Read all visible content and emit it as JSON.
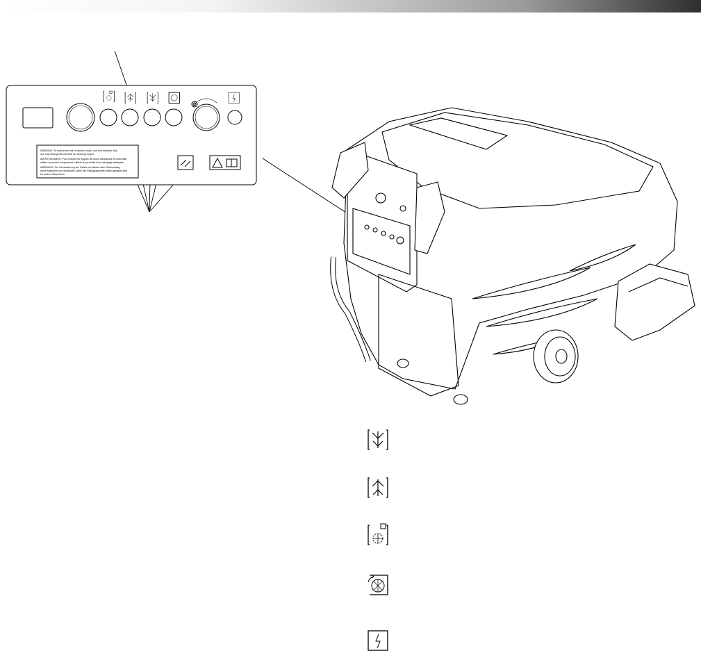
{
  "header": {
    "bar_colors": [
      "#ffffff",
      "#9a9a9a",
      "#2e2e2e"
    ]
  },
  "control_panel": {
    "warning_label": {
      "lines": [
        "WARNING: To reduce the risk of electric shock, use this machine only",
        "use only detergents intended for cleaning carpet.",
        "AVERTISSEMENT: Pour reduire les risques de chocs electriques et d'incendie",
        "utiliser ce produit uniquement. Utiliser les produits d'un nettoyage adequate.",
        "WARNUNG: Zur Verminderung der Gefahr von Brand oder Stromschlag",
        "diese Maschine nur verwenden, wenn die Reinigungsmittel dafur geeignet sind",
        "fur andere Maschinen."
      ]
    },
    "icons": [
      "pump-spray-icon",
      "vacuum-up-icon",
      "vacuum-down-icon",
      "brush-icon",
      "power-icon",
      "tools-icon",
      "read-manual-warning-icon"
    ]
  },
  "machine": {
    "name_icon": "carpet-extractor-icon"
  },
  "symbol_legend": {
    "items": [
      {
        "icon": "vacuum-down-icon",
        "text": ""
      },
      {
        "icon": "vacuum-up-icon",
        "text": ""
      },
      {
        "icon": "pump-spray-icon",
        "text": ""
      },
      {
        "icon": "brush-icon",
        "text": ""
      },
      {
        "icon": "power-icon",
        "text": ""
      }
    ]
  }
}
